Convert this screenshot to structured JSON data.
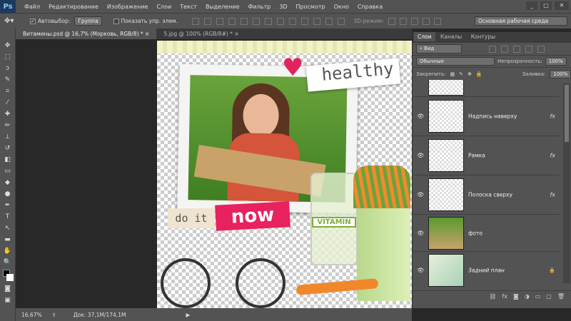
{
  "app": {
    "logo": "Ps"
  },
  "menu": [
    "Файл",
    "Редактирование",
    "Изображение",
    "Слои",
    "Текст",
    "Выделение",
    "Фильтр",
    "3D",
    "Просмотр",
    "Окно",
    "Справка"
  ],
  "window": {
    "minimize": "_",
    "maximize": "□",
    "close": "✕"
  },
  "options": {
    "autoselect_label": "Автовыбор:",
    "autoselect_value": "Группа",
    "show_controls": "Показать упр. элем.",
    "mode3d": "3D-режим:",
    "workspace": "Основная рабочая среда"
  },
  "tabs": [
    {
      "label": "Витамины.psd @ 16,7% (Морковь, RGB/8) *",
      "close": "×"
    },
    {
      "label": "5.jpg @ 100% (RGB/8#) *",
      "close": "×"
    }
  ],
  "artwork": {
    "healthy": "healthy",
    "do_it": "do it",
    "now": "now",
    "vitamin": "VITAMIN"
  },
  "panel": {
    "tabs": [
      "Слои",
      "Каналы",
      "Контуры"
    ],
    "filter": "Вид",
    "blend": "Обычные",
    "opacity_label": "Непрозрачность:",
    "opacity": "100%",
    "lock_label": "Закрепить:",
    "fill_label": "Заливка:",
    "fill": "100%",
    "layers": [
      {
        "name": "",
        "fx": ""
      },
      {
        "name": "Надпись наверху",
        "fx": "fx"
      },
      {
        "name": "Рамка",
        "fx": "fx"
      },
      {
        "name": "Полоска сверху",
        "fx": "fx"
      },
      {
        "name": "фото",
        "fx": ""
      },
      {
        "name": "Задний план",
        "fx": "🔒"
      }
    ]
  },
  "status": {
    "zoom": "16,67%",
    "doc": "Док: 37,1M/174,1M"
  }
}
